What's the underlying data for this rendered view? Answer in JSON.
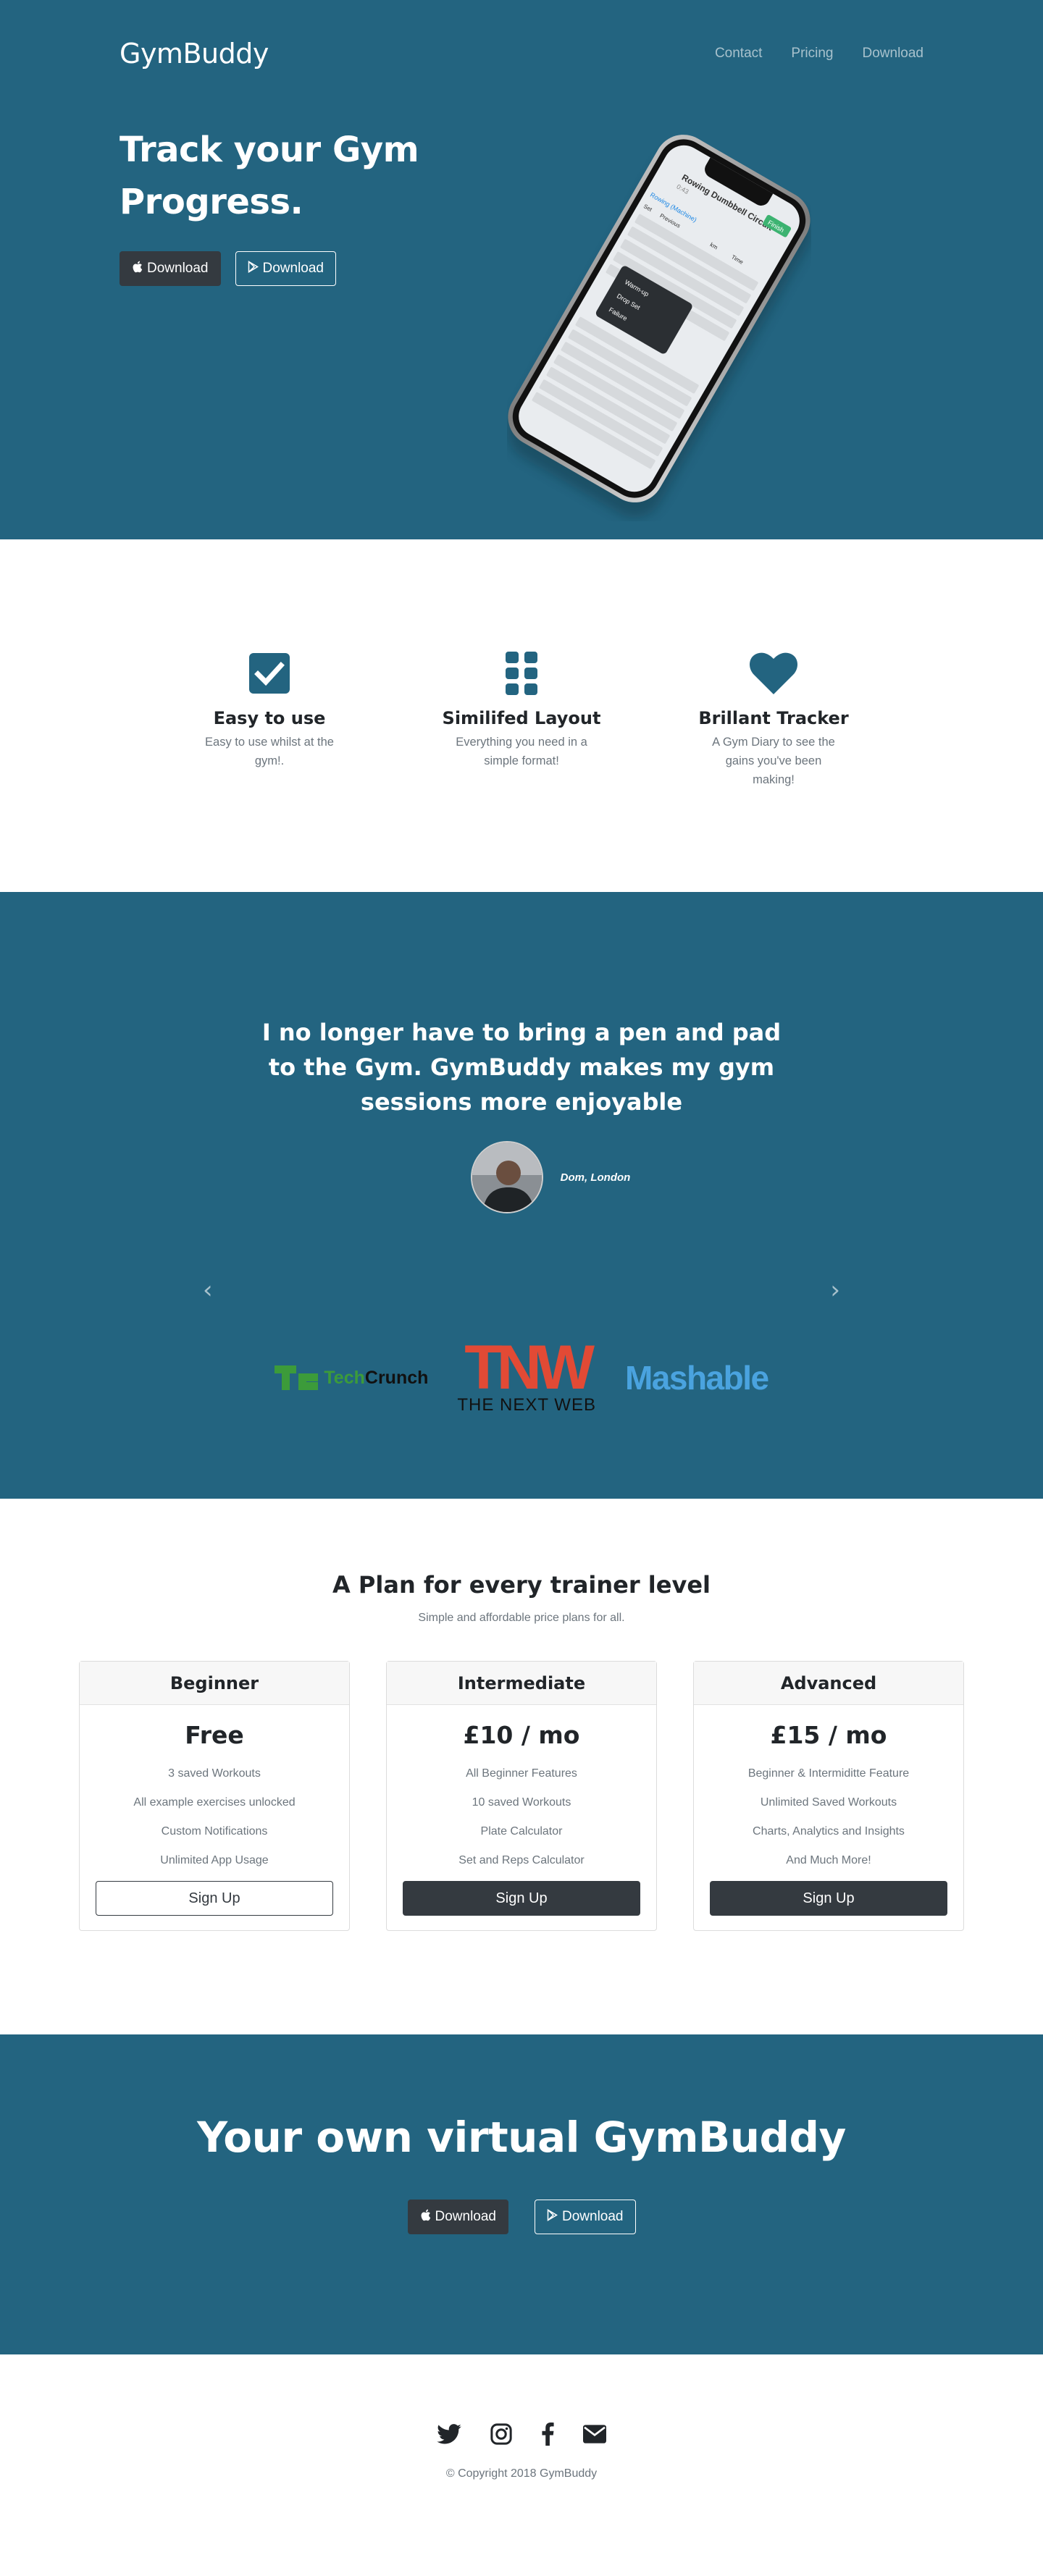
{
  "nav": {
    "brand": "GymBuddy",
    "links": [
      "Contact",
      "Pricing",
      "Download"
    ]
  },
  "hero": {
    "title": "Track your Gym Progress.",
    "btn_apple": "Download",
    "btn_play": "Download",
    "phone": {
      "workout_title": "Rowing Dumbbell Circuit",
      "time": "0:43",
      "finish": "Finish",
      "exercise": "Rowing (Machine)",
      "col_set": "Set",
      "col_prev": "Previous",
      "col_km": "km",
      "col_time": "Time",
      "menu": [
        "Warm-up",
        "Drop Set",
        "Failure"
      ]
    }
  },
  "features": [
    {
      "icon": "check-square-icon",
      "title": "Easy to use",
      "text": "Easy to use whilst at the gym!."
    },
    {
      "icon": "grid-icon",
      "title": "Similifed Layout",
      "text": "Everything you need in a simple format!"
    },
    {
      "icon": "heart-icon",
      "title": "Brillant Tracker",
      "text": "A Gym Diary to see the gains you've been making!"
    }
  ],
  "testimonial": {
    "quote": "I no longer have to bring a pen and pad to the Gym. GymBuddy makes my gym sessions more enjoyable",
    "author": "Dom, London"
  },
  "press": {
    "techcrunch_a": "Tech",
    "techcrunch_b": "Crunch",
    "tnw": "TNW",
    "tnw_sub": "THE NEXT WEB",
    "mashable": "Mashable"
  },
  "pricing": {
    "title": "A Plan for every trainer level",
    "subtitle": "Simple and affordable price plans for all.",
    "plans": [
      {
        "name": "Beginner",
        "price": "Free",
        "features": [
          "3 saved Workouts",
          "All example exercises unlocked",
          "Custom Notifications",
          "Unlimited App Usage"
        ],
        "button": "Sign Up"
      },
      {
        "name": "Intermediate",
        "price": "£10 / mo",
        "features": [
          "All Beginner Features",
          "10 saved Workouts",
          "Plate Calculator",
          "Set and Reps Calculator"
        ],
        "button": "Sign Up"
      },
      {
        "name": "Advanced",
        "price": "£15 / mo",
        "features": [
          "Beginner & Intermiditte Feature",
          "Unlimited Saved Workouts",
          "Charts, Analytics and Insights",
          "And Much More!"
        ],
        "button": "Sign Up"
      }
    ]
  },
  "cta": {
    "title": "Your own virtual GymBuddy",
    "btn_apple": "Download",
    "btn_play": "Download"
  },
  "footer": {
    "copyright": "© Copyright 2018 GymBuddy"
  },
  "colors": {
    "primary": "#236480",
    "dark": "#343a40",
    "muted": "#6c757d"
  }
}
